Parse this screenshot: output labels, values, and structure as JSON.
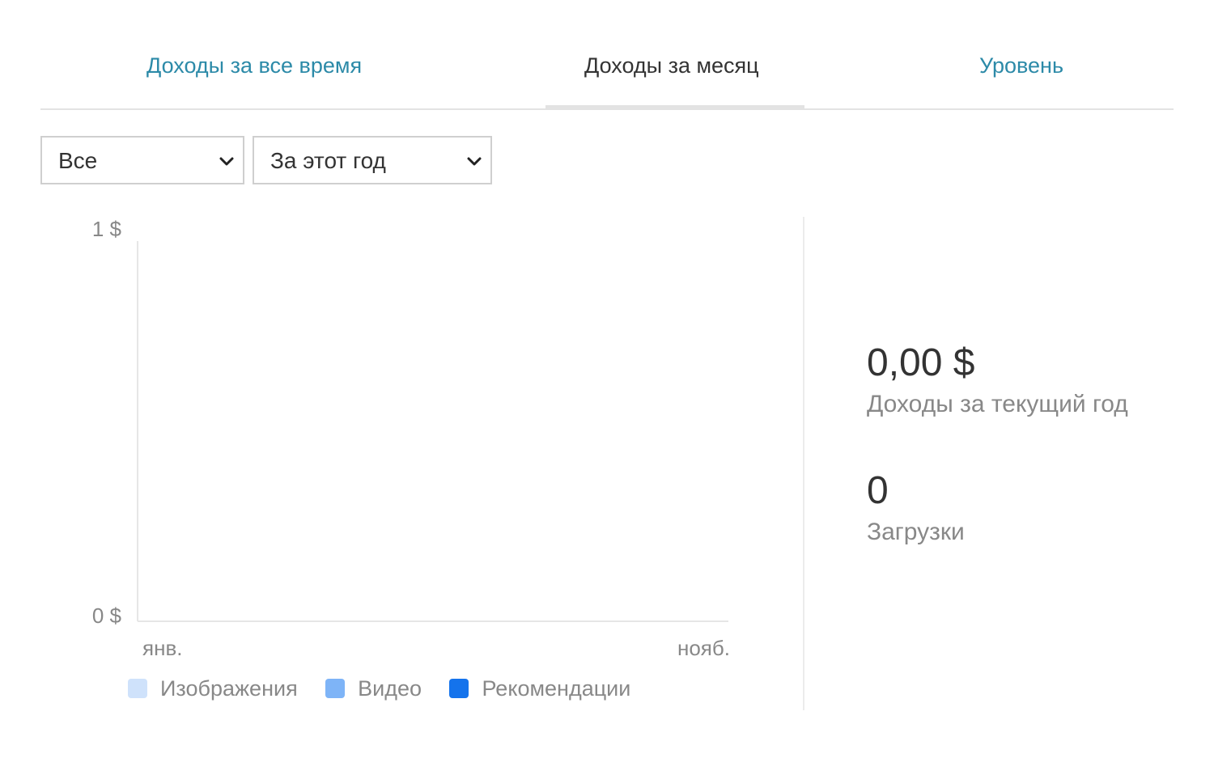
{
  "tabs": [
    {
      "label": "Доходы за все время",
      "active": false
    },
    {
      "label": "Доходы за месяц",
      "active": true
    },
    {
      "label": "Уровень",
      "active": false
    }
  ],
  "filters": {
    "type_select": {
      "value": "Все"
    },
    "period_select": {
      "value": "За этот год"
    }
  },
  "chart_data": {
    "type": "bar",
    "categories": [
      "янв.",
      "нояб."
    ],
    "x_tick_labels": [
      "янв.",
      "нояб."
    ],
    "y_tick_labels": [
      "1 $",
      "0 $"
    ],
    "ylim": [
      0,
      1
    ],
    "grid": false,
    "legend_position": "bottom",
    "series": [
      {
        "name": "Изображения",
        "color": "#cfe2fb",
        "values": [
          0,
          0
        ]
      },
      {
        "name": "Видео",
        "color": "#7eb4f7",
        "values": [
          0,
          0
        ]
      },
      {
        "name": "Рекомендации",
        "color": "#1473ec",
        "values": [
          0,
          0
        ]
      }
    ]
  },
  "stats": {
    "year_earnings_value": "0,00 $",
    "year_earnings_label": "Доходы за текущий год",
    "downloads_value": "0",
    "downloads_label": "Загрузки"
  },
  "colors": {
    "link": "#2c8aa8",
    "text": "#333333",
    "muted": "#888888"
  }
}
